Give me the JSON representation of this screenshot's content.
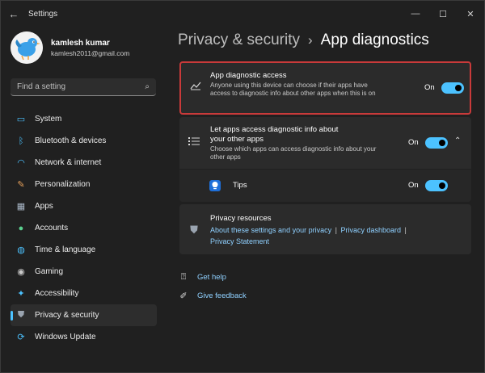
{
  "window": {
    "title": "Settings"
  },
  "profile": {
    "name": "kamlesh kumar",
    "email": "kamlesh2011@gmail.com"
  },
  "search": {
    "placeholder": "Find a setting"
  },
  "sidebar": {
    "items": [
      {
        "label": "System",
        "icon": "system-icon",
        "color": "#4cc2ff"
      },
      {
        "label": "Bluetooth & devices",
        "icon": "bluetooth-icon",
        "color": "#4cc2ff"
      },
      {
        "label": "Network & internet",
        "icon": "wifi-icon",
        "color": "#4cc2ff"
      },
      {
        "label": "Personalization",
        "icon": "brush-icon",
        "color": "#e8a15c"
      },
      {
        "label": "Apps",
        "icon": "apps-icon",
        "color": "#aab8c8"
      },
      {
        "label": "Accounts",
        "icon": "accounts-icon",
        "color": "#5bd08f"
      },
      {
        "label": "Time & language",
        "icon": "globe-clock-icon",
        "color": "#4cc2ff"
      },
      {
        "label": "Gaming",
        "icon": "controller-icon",
        "color": "#c8c8c8"
      },
      {
        "label": "Accessibility",
        "icon": "accessibility-icon",
        "color": "#4cc2ff"
      },
      {
        "label": "Privacy & security",
        "icon": "shield-icon",
        "color": "#9aa4b0"
      },
      {
        "label": "Windows Update",
        "icon": "update-icon",
        "color": "#4cc2ff"
      }
    ],
    "active_index": 9
  },
  "breadcrumb": {
    "parent": "Privacy & security",
    "separator": "›",
    "current": "App diagnostics"
  },
  "settings": {
    "app_diagnostic_access": {
      "title": "App diagnostic access",
      "description": "Anyone using this device can choose if their apps have access to diagnostic info about other apps when this is on",
      "state_label": "On"
    },
    "let_apps_access": {
      "title": "Let apps access diagnostic info about your other apps",
      "description": "Choose which apps can access diagnostic info about your other apps",
      "state_label": "On"
    },
    "tips": {
      "title": "Tips",
      "state_label": "On"
    },
    "privacy_resources": {
      "title": "Privacy resources",
      "link_1": "About these settings and your privacy",
      "separator": "|",
      "link_2": "Privacy dashboard",
      "link_3": "Privacy Statement"
    }
  },
  "help": {
    "get_help": "Get help",
    "give_feedback": "Give feedback"
  },
  "colors": {
    "accent": "#4cc2ff",
    "highlight_border": "#c93a3a",
    "link": "#8fd0ff"
  }
}
